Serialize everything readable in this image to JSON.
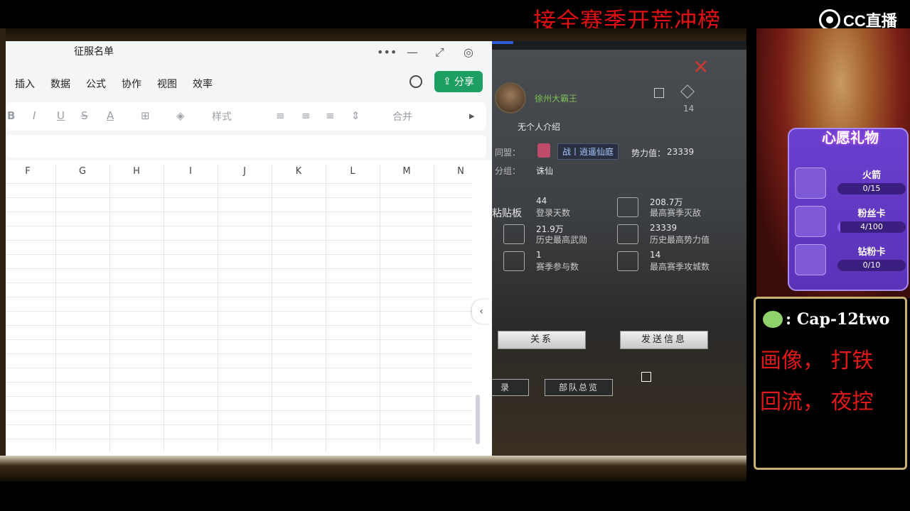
{
  "banner": {
    "text": "接全赛季开荒冲榜"
  },
  "logo": {
    "text": "CC直播"
  },
  "spreadsheet": {
    "title": "征服名单",
    "window_controls": [
      "•••",
      "—",
      "⤢",
      "◎"
    ],
    "menu": [
      "插入",
      "数据",
      "公式",
      "协作",
      "视图",
      "效率"
    ],
    "share_label": "分享",
    "toolbar": [
      "B",
      "I",
      "U",
      "S",
      "A",
      "⊞",
      "◈",
      "样式",
      "≡",
      "≡",
      "≡",
      "⇕",
      "合并",
      "▸"
    ],
    "columns": [
      "F",
      "G",
      "H",
      "I",
      "J",
      "K",
      "L",
      "M",
      "N"
    ],
    "collapse_glyph": "‹"
  },
  "game": {
    "close_glyph": "✕",
    "player_name": "徐州大霸王",
    "mail_count": "14",
    "intro": "无个人介绍",
    "alliance_label": "同盟：",
    "alliance_name": "战丨逍遥仙庭",
    "power_label": "势力值：",
    "power_value": "23339",
    "group_label": "分组：",
    "group_value": "诛仙",
    "paste_board": "粘贴板",
    "stats": [
      {
        "value": "44",
        "label": "登录天数"
      },
      {
        "value": "208.7万",
        "label": "最高赛季灭敌"
      },
      {
        "value": "21.9万",
        "label": "历史最高武勋"
      },
      {
        "value": "23339",
        "label": "历史最高势力值"
      },
      {
        "value": "1",
        "label": "赛季参与数"
      },
      {
        "value": "14",
        "label": "最高赛季攻城数"
      }
    ],
    "buttons": {
      "relation": "关系",
      "send": "发送信息"
    },
    "tabs": [
      "录",
      "部队总览"
    ]
  },
  "gifts": {
    "title": "心愿礼物",
    "items": [
      {
        "name": "火箭",
        "progress": "0/15",
        "fill": 0
      },
      {
        "name": "粉丝卡",
        "progress": "4/100",
        "fill": 0.04
      },
      {
        "name": "钻粉卡",
        "progress": "0/10",
        "fill": 0
      }
    ]
  },
  "contact": {
    "wechat": ": Cap-12two",
    "line1": "画像， 打铁",
    "line2": "回流， 夜控"
  }
}
